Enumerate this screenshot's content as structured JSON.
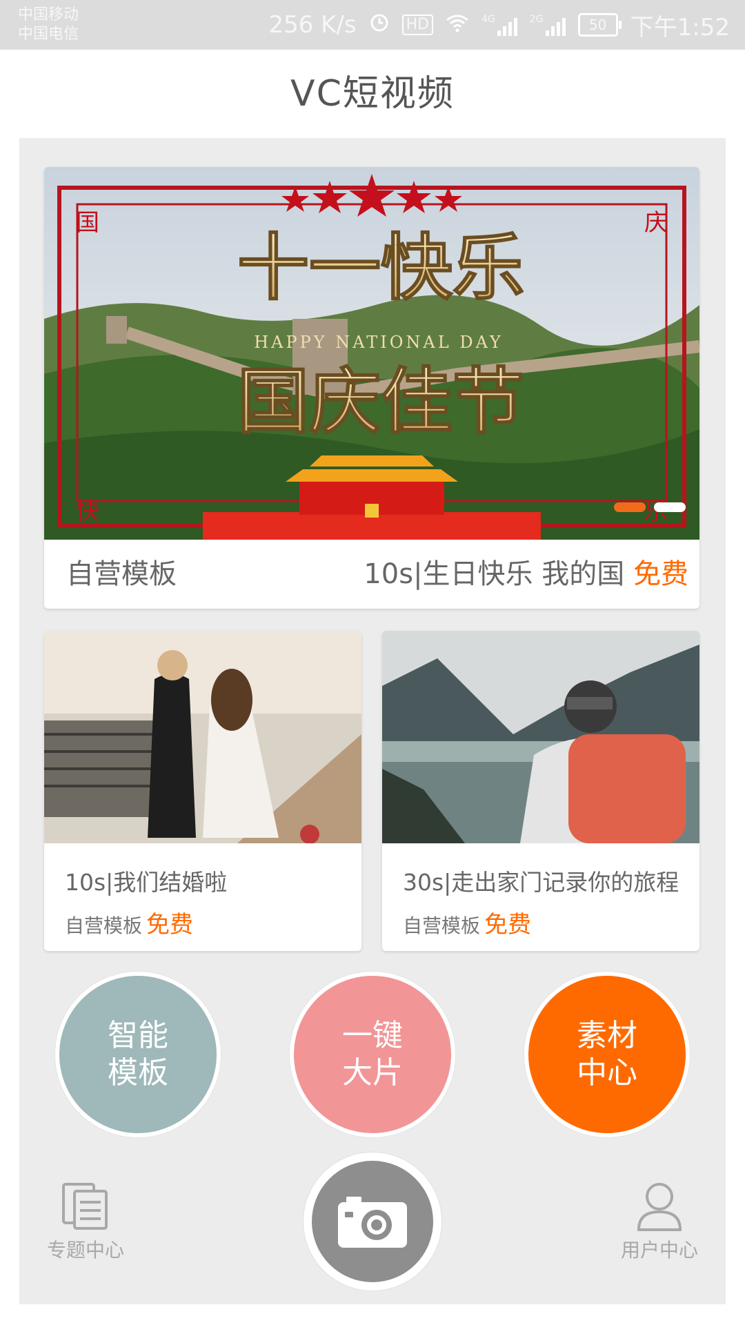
{
  "status_bar": {
    "carrier_1": "中国移动",
    "carrier_2": "中国电信",
    "speed": "256 K/s",
    "hd": "HD",
    "net_1": "4G",
    "net_2": "2G",
    "battery": "50",
    "time": "下午1:52"
  },
  "app_title": "VC短视频",
  "banner": {
    "image_text_main": "十一快乐",
    "image_text_sub": "HAPPY NATIONAL DAY",
    "image_text_big": "国庆佳节",
    "corner_tl": "国",
    "corner_tr": "庆",
    "corner_bl": "快",
    "corner_br": "乐",
    "label_left": "自营模板",
    "label_right": "10s|生日快乐 我的国",
    "price": "免费",
    "active_dot": 1,
    "dot_count": 2
  },
  "cards": [
    {
      "title": "10s|我们结婚啦",
      "tag": "自营模板",
      "price": "免费"
    },
    {
      "title": "30s|走出家门记录你的旅程",
      "tag": "自营模板",
      "price": "免费"
    }
  ],
  "actions": [
    {
      "line1": "智能",
      "line2": "模板",
      "color": "#9fb8ba"
    },
    {
      "line1": "一键",
      "line2": "大片",
      "color": "#f29597"
    },
    {
      "line1": "素材",
      "line2": "中心",
      "color": "#ff6a00"
    }
  ],
  "bottom_nav": {
    "left_label": "专题中心",
    "right_label": "用户中心",
    "center_icon": "camera-icon"
  },
  "colors": {
    "accent": "#ff6a00",
    "panel_bg": "#ececec"
  }
}
